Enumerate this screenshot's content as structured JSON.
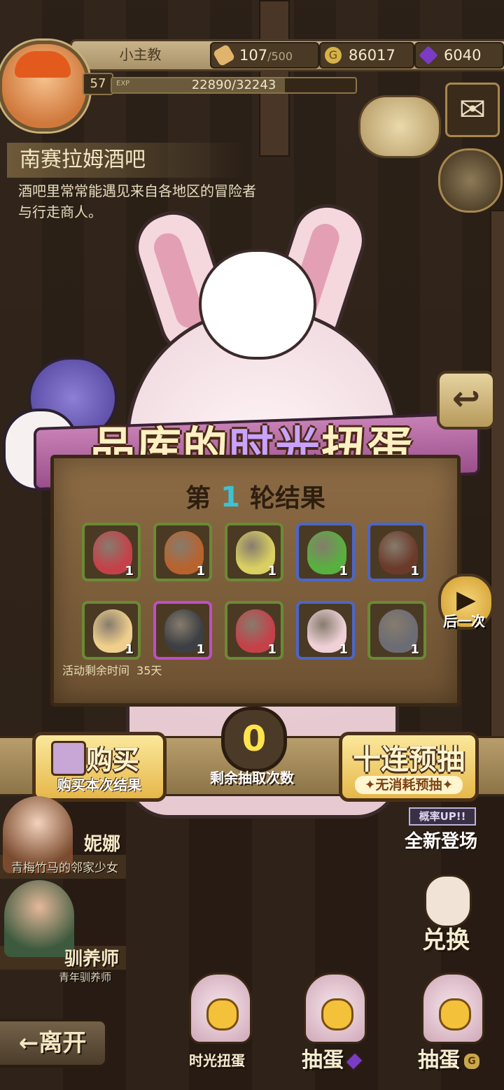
{
  "player": {
    "name": "小主教",
    "level": "57",
    "exp_label": "EXP",
    "exp_text": "22890/32243",
    "exp_progress": 0.71
  },
  "resources": {
    "stamina_value": "107",
    "stamina_max": "/500",
    "gold": "86017",
    "gems": "6040",
    "gold_icon": "G"
  },
  "location": {
    "title": "南赛拉姆酒吧",
    "description": "酒吧里常常能遇见来自各地区的冒险者与行走商人。"
  },
  "banner": {
    "part1": "品库的",
    "part2": "时光",
    "part3": "扭蛋"
  },
  "results": {
    "round_prefix": "第",
    "round_number": "1",
    "round_suffix": "轮结果",
    "items": [
      {
        "icon": "red-striped-egg",
        "count": "1",
        "rarity": "green",
        "color": "#c5414a"
      },
      {
        "icon": "flame-nest-egg",
        "count": "1",
        "rarity": "green",
        "color": "#b8632e"
      },
      {
        "icon": "yellow-crystal-egg",
        "count": "1",
        "rarity": "green",
        "color": "#d9cf62"
      },
      {
        "icon": "green-swirl-egg",
        "count": "1",
        "rarity": "blue",
        "color": "#58b040"
      },
      {
        "icon": "dark-flame-nest",
        "count": "1",
        "rarity": "blue",
        "color": "#6b3a2a"
      },
      {
        "icon": "cream-swirl-egg",
        "count": "1",
        "rarity": "green",
        "color": "#f0cf8c"
      },
      {
        "icon": "dark-horned-nest",
        "count": "1",
        "rarity": "purple",
        "color": "#3c3f44"
      },
      {
        "icon": "red-striped-egg",
        "count": "1",
        "rarity": "green",
        "color": "#c5414a"
      },
      {
        "icon": "ribbon-gift-egg",
        "count": "1",
        "rarity": "blue",
        "color": "#eed0d6"
      },
      {
        "icon": "gray-cracked-egg",
        "count": "1",
        "rarity": "green",
        "color": "#6c6c74"
      }
    ],
    "timer_label": "活动剩余时间",
    "timer_value": "35天"
  },
  "actions": {
    "next_icon": "▶",
    "next_label": "后一次",
    "return_icon": "↩",
    "buy_main": "购买",
    "buy_sub": "购买本次结果",
    "remaining_count": "0",
    "remaining_label": "剩余抽取次数",
    "ten_main": "十连预抽",
    "ten_sub": "✦无消耗预抽✦"
  },
  "characters": [
    {
      "name": "妮娜",
      "subtitle": "青梅竹马的邻家少女"
    },
    {
      "name": "驯养师",
      "subtitle": "青年驯养师"
    }
  ],
  "side": {
    "new_up": "概率UP!!",
    "new_main": "全新登场",
    "exchange": "兑换",
    "mail_icon": "✉"
  },
  "bottom": {
    "leave": "←离开",
    "time_gacha": "时光扭蛋",
    "gacha_gem": "抽蛋",
    "gacha_gold": "抽蛋",
    "gold_icon": "G"
  },
  "colors": {
    "rarity_green": "#6b8a34",
    "rarity_blue": "#4c66c9",
    "rarity_purple": "#c14dc6",
    "count_yellow": "#ffe44d",
    "round_cyan": "#3cc2d6"
  }
}
